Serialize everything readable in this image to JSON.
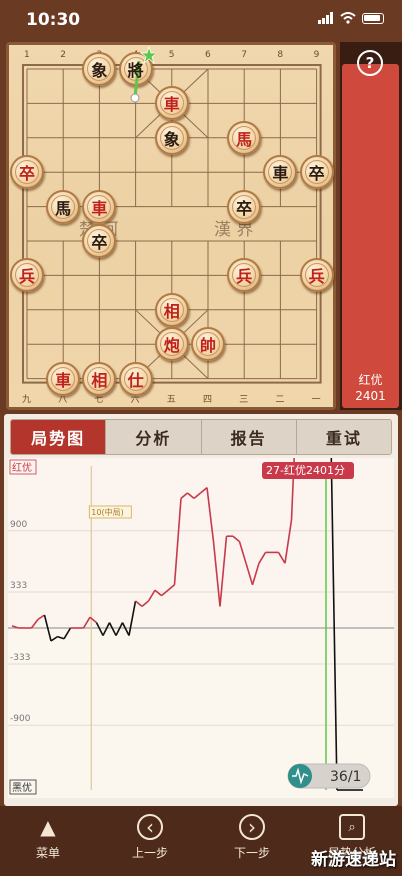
{
  "status": {
    "time": "10:30"
  },
  "board": {
    "top_files": [
      "1",
      "2",
      "3",
      "4",
      "5",
      "6",
      "7",
      "8",
      "9"
    ],
    "bottom_files": [
      "九",
      "八",
      "七",
      "六",
      "五",
      "四",
      "三",
      "二",
      "一"
    ],
    "river_left": "楚 河",
    "river_right": "漢 界"
  },
  "pieces": [
    {
      "c": "black",
      "t": "象",
      "col": 2,
      "row": 0
    },
    {
      "c": "black",
      "t": "將",
      "col": 3,
      "row": 0
    },
    {
      "c": "red",
      "t": "車",
      "col": 4,
      "row": 1
    },
    {
      "c": "black",
      "t": "象",
      "col": 4,
      "row": 2
    },
    {
      "c": "red",
      "t": "馬",
      "col": 6,
      "row": 2
    },
    {
      "c": "red",
      "t": "卒",
      "col": 0,
      "row": 3
    },
    {
      "c": "black",
      "t": "車",
      "col": 7,
      "row": 3
    },
    {
      "c": "black",
      "t": "卒",
      "col": 8,
      "row": 3
    },
    {
      "c": "black",
      "t": "馬",
      "col": 1,
      "row": 4
    },
    {
      "c": "red",
      "t": "車",
      "col": 2,
      "row": 4
    },
    {
      "c": "black",
      "t": "卒",
      "col": 6,
      "row": 4
    },
    {
      "c": "black",
      "t": "卒",
      "col": 2,
      "row": 5
    },
    {
      "c": "red",
      "t": "兵",
      "col": 0,
      "row": 6
    },
    {
      "c": "red",
      "t": "兵",
      "col": 6,
      "row": 6
    },
    {
      "c": "red",
      "t": "兵",
      "col": 8,
      "row": 6
    },
    {
      "c": "red",
      "t": "相",
      "col": 4,
      "row": 7
    },
    {
      "c": "red",
      "t": "炮",
      "col": 4,
      "row": 8
    },
    {
      "c": "red",
      "t": "帥",
      "col": 5,
      "row": 8
    },
    {
      "c": "red",
      "t": "車",
      "col": 1,
      "row": 9
    },
    {
      "c": "red",
      "t": "相",
      "col": 2,
      "row": 9
    },
    {
      "c": "red",
      "t": "仕",
      "col": 3,
      "row": 9
    }
  ],
  "side": {
    "help": "?",
    "label_line1": "红优",
    "label_line2": "2401"
  },
  "tabs": [
    "局势图",
    "分析",
    "报告",
    "重试"
  ],
  "chart_data": {
    "type": "line",
    "top_label": "红优",
    "bottom_label": "黑优",
    "y_ticks": [
      "900",
      "333",
      "-333",
      "-900"
    ],
    "ylim": [
      -1500,
      1500
    ],
    "marker_label": "10(中局)",
    "marker_move": 10,
    "callout": "27-红优2401分",
    "counter": "36/1",
    "values": [
      20,
      0,
      0,
      0,
      80,
      120,
      -120,
      -80,
      -100,
      0,
      0,
      0,
      100,
      50,
      -70,
      50,
      -70,
      50,
      -70,
      250,
      200,
      250,
      350,
      300,
      350,
      400,
      1200,
      1250,
      1200,
      1250,
      1300,
      800,
      200,
      850,
      850,
      800,
      600,
      400,
      600,
      700,
      700,
      700,
      600,
      1000,
      2401,
      2401,
      2300,
      2401,
      2200,
      2000,
      -1500,
      -1500,
      -1500,
      -1500,
      -1500
    ]
  },
  "nav": [
    {
      "label": "菜单",
      "icon": "▲"
    },
    {
      "label": "上一步",
      "icon": "‹"
    },
    {
      "label": "下一步",
      "icon": "›"
    },
    {
      "label": "局势分析",
      "icon": "⌕"
    }
  ],
  "watermark": "新游速递站",
  "colors": {
    "accent": "#b4352b",
    "line_red": "#c9394a",
    "line_black": "#111111",
    "marker_green": "#5fc64a"
  }
}
